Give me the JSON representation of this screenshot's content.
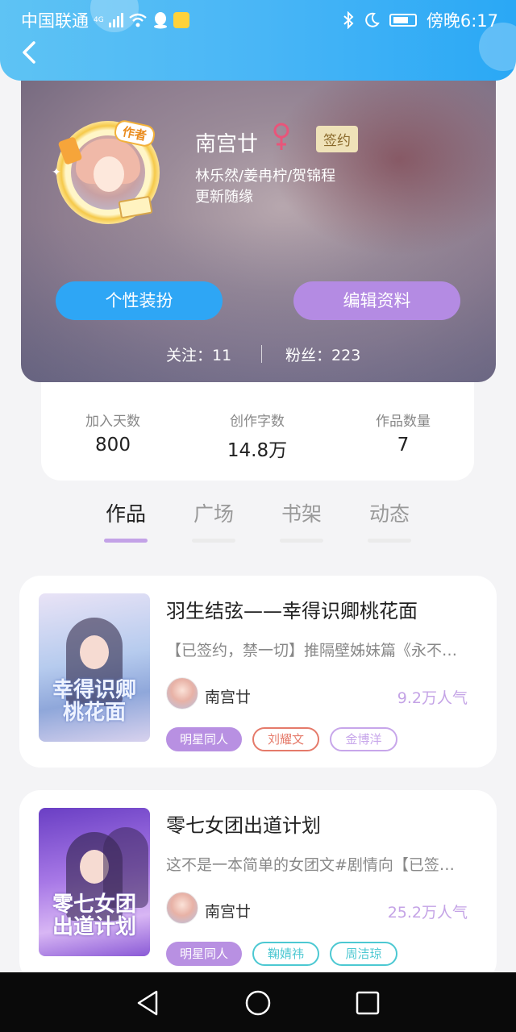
{
  "status_bar": {
    "carrier": "中国联通",
    "network": "4G",
    "time_prefix": "傍晚",
    "time": "6:17",
    "icons": [
      "signal-bars-icon",
      "wifi-icon",
      "qq-icon",
      "app-notification-icon",
      "bluetooth-icon",
      "moon-icon",
      "battery-icon"
    ]
  },
  "header": {
    "back_icon": "chevron-left-icon"
  },
  "profile": {
    "name": "南宫廿",
    "gender_icon": "female-icon",
    "badge": "签约",
    "avatar_tag": "作者",
    "characters": "林乐然/姜冉柠/贺锦程",
    "update_note": "更新随缘",
    "buttons": {
      "dress_up": "个性装扮",
      "edit_profile": "编辑资料"
    },
    "follow_label": "关注：",
    "follow_count": "11",
    "fans_label": "粉丝：",
    "fans_count": "223",
    "colors": {
      "dress_button": "#2ea6f5",
      "edit_button": "#b48be3"
    }
  },
  "stats": [
    {
      "label": "加入天数",
      "value": "800"
    },
    {
      "label": "创作字数",
      "value": "14.8万"
    },
    {
      "label": "作品数量",
      "value": "7"
    }
  ],
  "tabs": [
    {
      "label": "作品",
      "active": true
    },
    {
      "label": "广场",
      "active": false
    },
    {
      "label": "书架",
      "active": false
    },
    {
      "label": "动态",
      "active": false
    }
  ],
  "books": [
    {
      "title": "羽生结弦——幸得识卿桃花面",
      "cover_text": "幸得识卿桃花面",
      "description": "【已签约，禁一切】推隔壁姊妹篇《永不…",
      "author": "南宫廿",
      "popularity": "9.2万人气",
      "tags": [
        {
          "label": "明星同人",
          "style": "fill",
          "color": "#b890e2"
        },
        {
          "label": "刘耀文",
          "style": "outline",
          "color": "#e57a6a"
        },
        {
          "label": "金博洋",
          "style": "outline",
          "color": "#c7a6ea"
        }
      ]
    },
    {
      "title": "零七女团出道计划",
      "cover_text": "零七女团出道计划",
      "description": "这不是一本简单的女团文#剧情向【已签…",
      "author": "南宫廿",
      "popularity": "25.2万人气",
      "tags": [
        {
          "label": "明星同人",
          "style": "fill",
          "color": "#b890e2"
        },
        {
          "label": "鞠婧祎",
          "style": "outline",
          "color": "#4cc8d2"
        },
        {
          "label": "周洁琼",
          "style": "outline",
          "color": "#4cc8d2"
        }
      ]
    }
  ],
  "nav_bar": {
    "icons": [
      "back-triangle-icon",
      "home-circle-icon",
      "recents-square-icon"
    ]
  }
}
